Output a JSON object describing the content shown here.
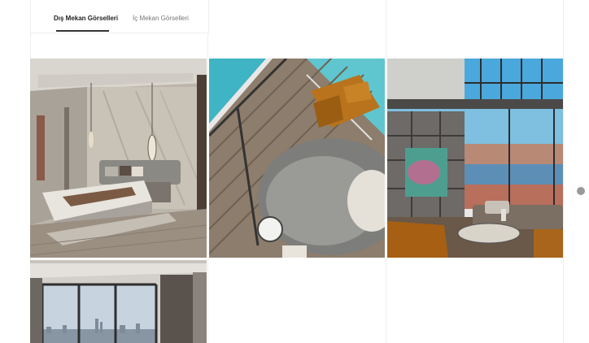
{
  "tabs": [
    {
      "label": "Dış Mekan Görselleri",
      "active": true
    },
    {
      "label": "İç Mekan Görselleri",
      "active": false
    }
  ],
  "gallery": {
    "images": [
      {
        "name": "bedroom"
      },
      {
        "name": "living-room-aerial"
      },
      {
        "name": "duplex-living-room"
      },
      {
        "name": "city-view-room"
      }
    ]
  },
  "colors": {
    "tab_active": "#222222",
    "tab_inactive": "#777777",
    "divider": "#eeeeee",
    "pager_dot": "#9a9a9a"
  },
  "icons": [
    "pager-dot-icon"
  ]
}
